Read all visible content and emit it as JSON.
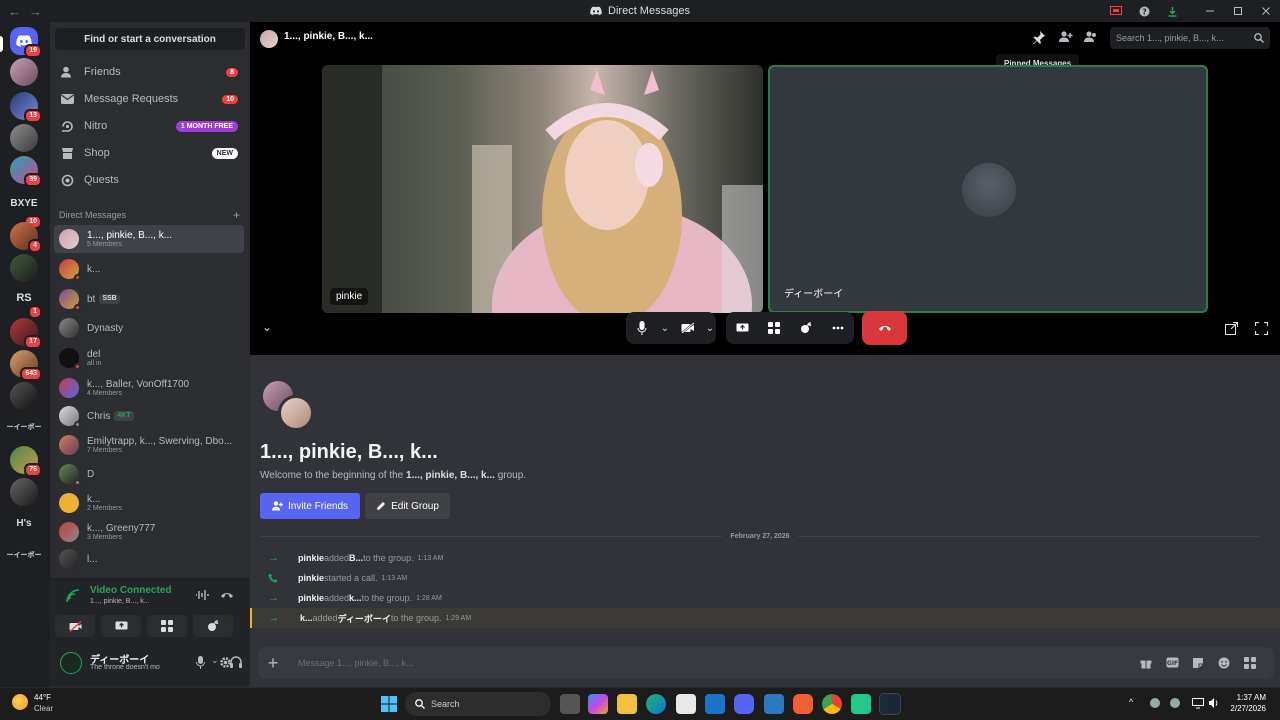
{
  "titlebar": {
    "title": "Direct Messages",
    "back": "←",
    "forward": "→"
  },
  "rail": {
    "servers": [
      {
        "badge": "19"
      },
      {
        "badge": ""
      },
      {
        "badge": "13"
      },
      {
        "badge": ""
      },
      {
        "badge": "39"
      },
      {
        "label": "BXYE",
        "badge": "10"
      },
      {
        "badge": "4"
      },
      {
        "badge": ""
      },
      {
        "label": "RS",
        "badge": "1"
      },
      {
        "badge": "17"
      },
      {
        "badge": "643"
      },
      {
        "badge": ""
      },
      {
        "label": "ーイーボー",
        "badge": ""
      },
      {
        "badge": "76"
      },
      {
        "badge": ""
      },
      {
        "label": "H's",
        "badge": ""
      },
      {
        "label": "ーイーボー",
        "badge": ""
      }
    ]
  },
  "sidebar": {
    "find": "Find or start a conversation",
    "nav": [
      {
        "label": "Friends",
        "badge": "8"
      },
      {
        "label": "Message Requests",
        "badge": "10"
      },
      {
        "label": "Nitro",
        "pill": "1 MONTH FREE"
      },
      {
        "label": "Shop",
        "pill": "NEW"
      },
      {
        "label": "Quests"
      }
    ],
    "dm_header": "Direct Messages",
    "dm_plus": "+",
    "dms": [
      {
        "name": "1..., pinkie, B..., k...",
        "sub": "5 Members"
      },
      {
        "name": "k...",
        "sub": ""
      },
      {
        "name": "bt",
        "tag": "SSB",
        "sub": ""
      },
      {
        "name": "Dynasty",
        "sub": ""
      },
      {
        "name": "del",
        "sub": "all in"
      },
      {
        "name": "k..., Baller, VonOff1700",
        "sub": "4 Members"
      },
      {
        "name": "Chris",
        "tag": "4KT",
        "sub": ""
      },
      {
        "name": "Emilytrapp, k..., Swerving, Dbo...",
        "sub": "7 Members"
      },
      {
        "name": "D",
        "sub": ""
      },
      {
        "name": "k...",
        "sub": "2 Members"
      },
      {
        "name": "k..., Greeny777",
        "sub": "3 Members"
      },
      {
        "name": "l...",
        "sub": ""
      }
    ],
    "voice": {
      "status": "Video Connected",
      "channel": "1..., pinkie, B..., k..."
    },
    "user": {
      "name": "ディーボーイ",
      "status": "The throne doesn't mo"
    }
  },
  "call": {
    "title": "1..., pinkie, B..., k...",
    "search_placeholder": "Search 1..., pinkie, B..., k...",
    "tooltip": "Pinned Messages",
    "tiles": [
      {
        "label": "pinkie"
      },
      {
        "label": "ディーボーイ"
      }
    ]
  },
  "chat": {
    "group_name": "1..., pinkie, B..., k...",
    "welcome_prefix": "Welcome to the beginning of the ",
    "welcome_group": "1..., pinkie, B..., k...",
    "welcome_suffix": " group.",
    "invite": "Invite Friends",
    "edit": "Edit Group",
    "date": "February 27, 2026",
    "messages": [
      {
        "who": "pinkie",
        "action": " added ",
        "target": "B...",
        "rest": " to the group.",
        "time": "1:13 AM",
        "icon": "→"
      },
      {
        "who": "pinkie",
        "action": " started a call.",
        "target": "",
        "rest": "",
        "time": "1:13 AM",
        "icon": "📞"
      },
      {
        "who": "pinkie",
        "action": " added ",
        "target": "k...",
        "rest": " to the group.",
        "time": "1:28 AM",
        "icon": "→"
      },
      {
        "who": "k...",
        "action": " added ",
        "target": "ディーボーイ",
        "rest": " to the group.",
        "time": "1:29 AM",
        "icon": "→"
      }
    ],
    "composer_placeholder": "Message 1..., pinkie, B..., k..."
  },
  "taskbar": {
    "weather_temp": "44°F",
    "weather_desc": "Clear",
    "search": "Search",
    "time": "1:37 AM",
    "date": "2/27/2026"
  },
  "colors": {
    "accent": "#5865f2",
    "danger": "#f23f43",
    "online": "#23a55a",
    "hangup": "#da373c"
  }
}
